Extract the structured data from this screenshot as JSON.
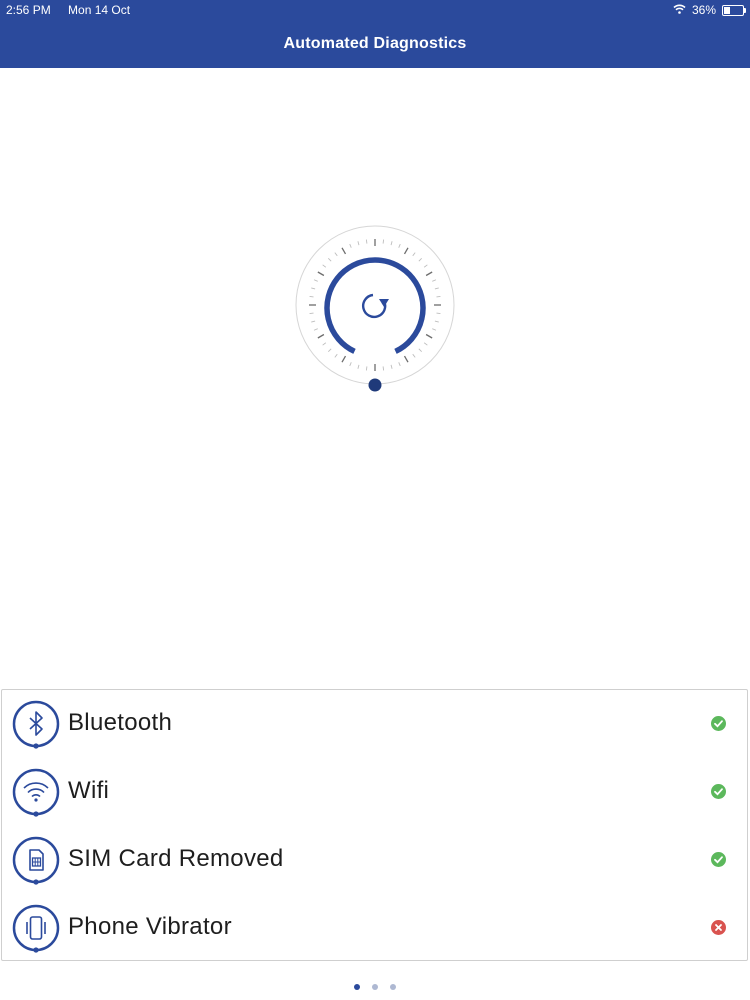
{
  "status_bar": {
    "time": "2:56 PM",
    "date": "Mon 14 Oct",
    "battery": "36%",
    "battery_level": 0.36
  },
  "header": {
    "title": "Automated Diagnostics"
  },
  "spinner": {
    "icon": "refresh-icon"
  },
  "diagnostics": [
    {
      "label": "Bluetooth",
      "icon": "bluetooth-icon",
      "status": "pass"
    },
    {
      "label": "Wifi",
      "icon": "wifi-icon",
      "status": "pass"
    },
    {
      "label": "SIM Card Removed",
      "icon": "sim-card-icon",
      "status": "pass"
    },
    {
      "label": "Phone Vibrator",
      "icon": "vibrate-icon",
      "status": "fail"
    }
  ],
  "pager": {
    "pages": 3,
    "current": 1
  },
  "colors": {
    "primary": "#2b4a9c",
    "pass": "#5cb85c",
    "fail": "#d9534f"
  }
}
